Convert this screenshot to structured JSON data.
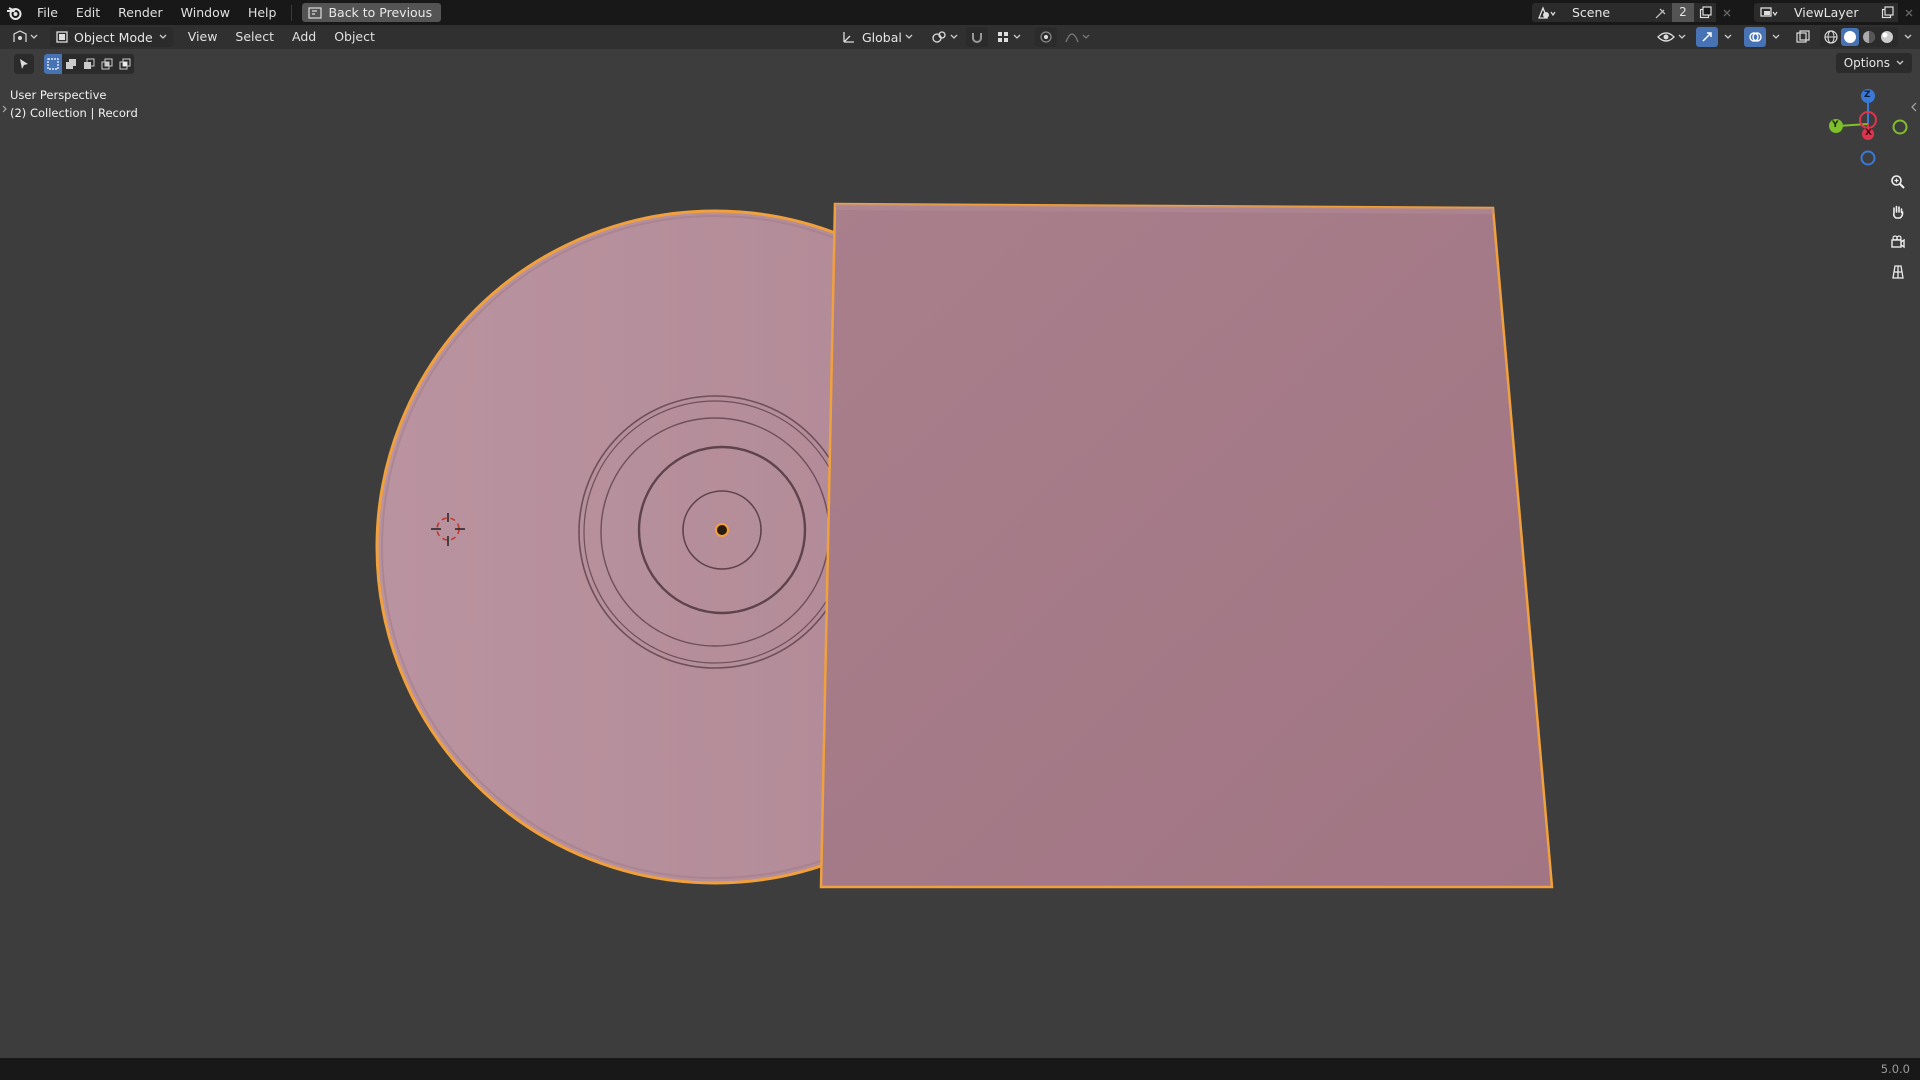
{
  "menubar": {
    "items": [
      "File",
      "Edit",
      "Render",
      "Window",
      "Help"
    ],
    "back_button": "Back to Previous",
    "scene_name": "Scene",
    "scene_users": "2",
    "view_layer": "ViewLayer"
  },
  "header": {
    "mode": "Object Mode",
    "menus": [
      "View",
      "Select",
      "Add",
      "Object"
    ],
    "orientation": "Global"
  },
  "toolbar": {
    "options_label": "Options"
  },
  "viewport": {
    "perspective": "User Perspective",
    "collection": "(2) Collection | Record",
    "gizmo": {
      "z": "Z",
      "y": "Y",
      "x": "X"
    }
  },
  "colors": {
    "accent": "#4772b3",
    "selection_outline": "#f0a03c",
    "object_fill": "#b48d9a",
    "axis_x": "#e0344e",
    "axis_y": "#7fbf2a",
    "axis_z": "#3a7ad6"
  },
  "statusbar": {
    "version": "5.0.0"
  }
}
